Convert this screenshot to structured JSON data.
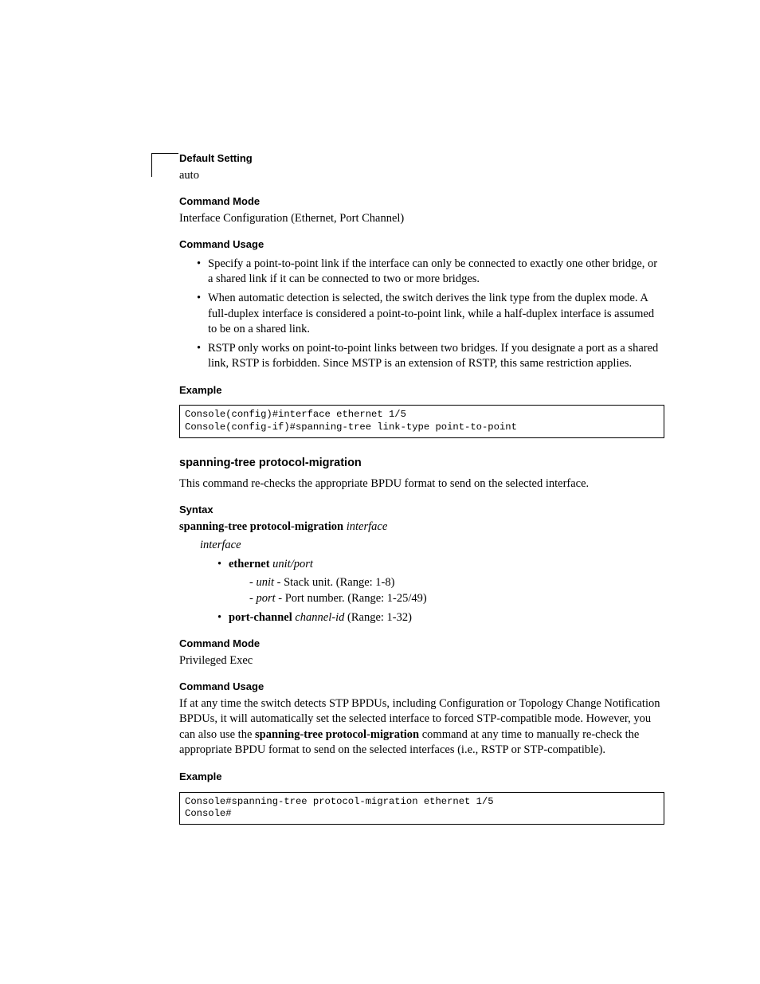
{
  "labels": {
    "defaultSetting": "Default Setting",
    "commandMode": "Command Mode",
    "commandUsage": "Command Usage",
    "example": "Example",
    "syntax": "Syntax"
  },
  "linktype": {
    "defaultSetting": "auto",
    "commandMode": "Interface Configuration (Ethernet, Port Channel)",
    "bullets": [
      "Specify a point-to-point link if the interface can only be connected to exactly one other bridge, or a shared link if it can be connected to two or more bridges.",
      "When automatic detection is selected, the switch derives the link type from the duplex mode. A full-duplex interface is considered a point-to-point link, while a half-duplex interface is assumed to be on a shared link.",
      "RSTP only works on point-to-point links between two bridges. If you designate a port as a shared link, RSTP is forbidden. Since MSTP is an extension of RSTP, this same restriction applies."
    ],
    "console": "Console(config)#interface ethernet 1/5\nConsole(config-if)#spanning-tree link-type point-to-point"
  },
  "protmig": {
    "heading": "spanning-tree protocol-migration",
    "intro": "This command re-checks the appropriate BPDU format to send on the selected interface.",
    "syntaxLine": "spanning-tree protocol-migration",
    "syntaxInterface": "interface",
    "syntaxBullets": {
      "intro": "interface",
      "eth": "ethernet",
      "ethDesc": "unit/port",
      "unit": "unit",
      "unitDesc": " - Stack unit. (Range: 1-8)",
      "port": "port",
      "portDesc": " - Port number. (Range: 1-25/49)",
      "pc": "port-channel",
      "pcItalic": "channel-id",
      "pcDesc": " (Range: 1-32)"
    },
    "commandMode": "Privileged Exec",
    "usage": "If at any time the switch detects STP BPDUs, including Configuration or Topology Change Notification BPDUs, it will automatically set the selected interface to forced STP-compatible mode. However, you can also use the ",
    "usageCmd": "spanning-tree protocol-migration",
    "usage2": " command at any time to manually re-check the appropriate BPDU format to send on the selected interfaces (i.e., RSTP or STP-compatible).",
    "console": "Console#spanning-tree protocol-migration ethernet 1/5\nConsole#"
  }
}
